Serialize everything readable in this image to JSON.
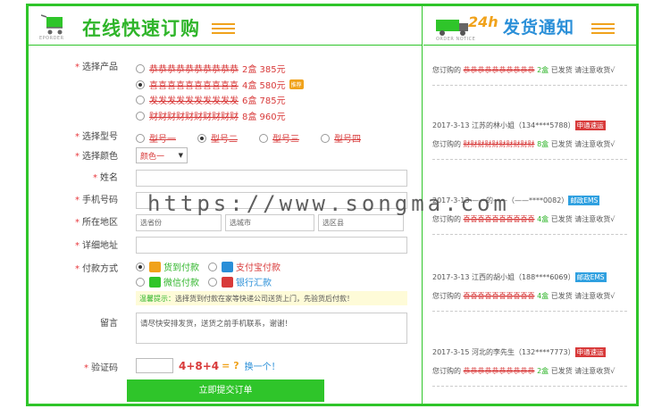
{
  "left_header": {
    "title": "在线快速订购",
    "sub": "EPORDER"
  },
  "right_header": {
    "title": "发货通知",
    "logo_num": "24h",
    "sub": "ORDER NOTICE"
  },
  "form": {
    "product_label": "选择产品",
    "products": [
      {
        "name": "恭恭恭恭恭恭恭恭恭恭",
        "price": "2盒 385元",
        "selected": false,
        "hot": ""
      },
      {
        "name": "喜喜喜喜喜喜喜喜喜喜",
        "price": "4盒 580元",
        "selected": true,
        "hot": "推荐"
      },
      {
        "name": "发发发发发发发发发发",
        "price": "6盒 785元",
        "selected": false,
        "hot": ""
      },
      {
        "name": "财财财财财财财财财财",
        "price": "8盒 960元",
        "selected": false,
        "hot": ""
      }
    ],
    "model_label": "选择型号",
    "models": [
      "型号一",
      "型号二",
      "型号三",
      "型号四"
    ],
    "model_selected": 1,
    "color_label": "选择颜色",
    "color_value": "颜色一",
    "name_label": "姓名",
    "phone_label": "手机号码",
    "region_label": "所在地区",
    "region_province": "选省份",
    "region_city": "选城市",
    "region_district": "选区县",
    "address_label": "详细地址",
    "pay_label": "付款方式",
    "pay_options": [
      "货到付款",
      "支付宝付款",
      "微信付款",
      "银行汇款"
    ],
    "tip_prefix": "温馨提示：",
    "tip_text": "选择货到付款在家等快递公司送货上门，先验货后付款！",
    "note_label": "留言",
    "note_text": "请尽快安排发货，送货之前手机联系，谢谢！",
    "captcha_label": "验证码",
    "captcha_expr": "4+8+4",
    "captcha_eq": "= ?",
    "captcha_refresh": "换一个！",
    "submit_label": "立即提交订单"
  },
  "shipments": [
    {
      "meta": "",
      "badge": "",
      "badge_color": "",
      "prefix": "您订购的",
      "product": "恭恭恭恭恭恭恭恭恭恭",
      "qty": "2盒",
      "suffix": "已发货 请注意收货√"
    },
    {
      "meta": "2017-3-13 江苏的林小姐（134****5788）",
      "badge": "申通速运",
      "badge_color": "red",
      "prefix": "您订购的",
      "product": "财财财财财财财财财财",
      "qty": "8盒",
      "suffix": "已发货 请注意收货√"
    },
    {
      "meta": "2017-3-13 ——的——（——****0082）",
      "badge": "邮政EMS",
      "badge_color": "blue",
      "prefix": "您订购的",
      "product": "喜喜喜喜喜喜喜喜喜喜",
      "qty": "4盒",
      "suffix": "已发货 请注意收货√"
    },
    {
      "meta": "2017-3-13 江西的胡小姐（188****6069）",
      "badge": "邮政EMS",
      "badge_color": "blue",
      "prefix": "您订购的",
      "product": "喜喜喜喜喜喜喜喜喜喜",
      "qty": "4盒",
      "suffix": "已发货 请注意收货√"
    },
    {
      "meta": "2017-3-15 河北的李先生（132****7773）",
      "badge": "申通速运",
      "badge_color": "red",
      "prefix": "您订购的",
      "product": "恭恭恭恭恭恭恭恭恭恭",
      "qty": "2盒",
      "suffix": "已发货 请注意收货√"
    }
  ],
  "watermark": "https://www.songma.com",
  "colors": {
    "green": "#2fc52a",
    "red": "#d83a3a",
    "blue": "#2a8fd8",
    "orange": "#f0a21b"
  }
}
